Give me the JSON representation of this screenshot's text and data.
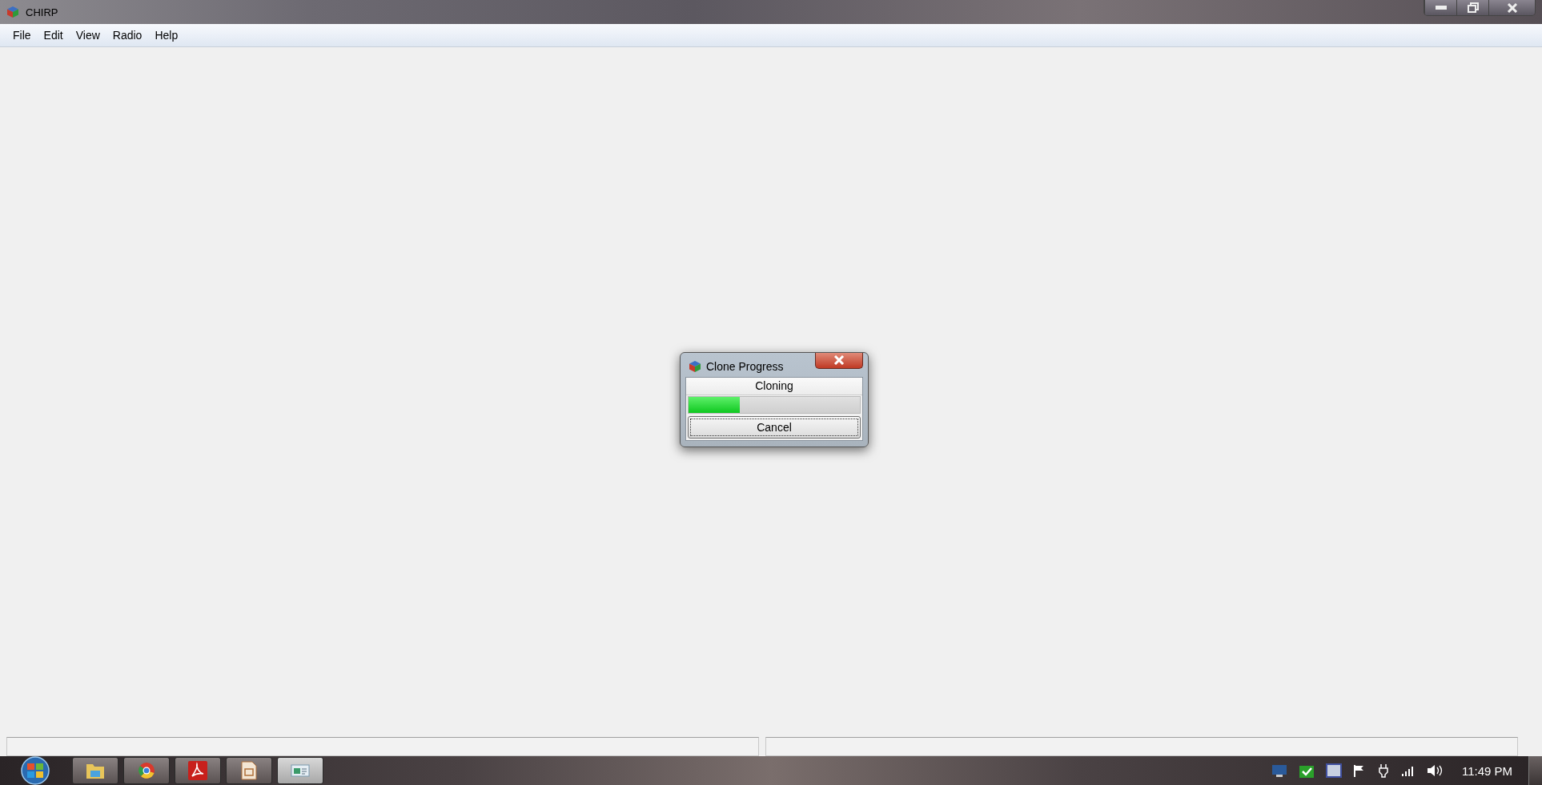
{
  "window": {
    "title": "CHIRP"
  },
  "menu": [
    {
      "label": "File"
    },
    {
      "label": "Edit"
    },
    {
      "label": "View"
    },
    {
      "label": "Radio"
    },
    {
      "label": "Help"
    }
  ],
  "dialog": {
    "title": "Clone Progress",
    "status": "Cloning",
    "progress": {
      "level": 0.3
    },
    "button": "Cancel"
  },
  "taskbar": {
    "apps": [
      {
        "kind": "folder",
        "selected": false
      },
      {
        "kind": "browser",
        "selected": false
      },
      {
        "kind": "pdf",
        "selected": false
      },
      {
        "kind": "document",
        "selected": false
      },
      {
        "kind": "window",
        "selected": true
      }
    ],
    "clock": "11:49 PM"
  }
}
